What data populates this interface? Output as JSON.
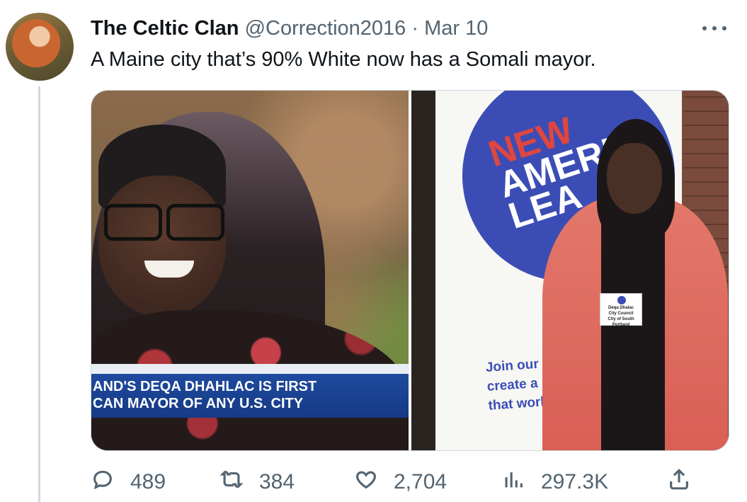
{
  "tweet": {
    "author": {
      "display_name": "The Celtic Clan",
      "handle": "@Correction2016",
      "separator": "·",
      "date": "Mar 10"
    },
    "text": "A Maine city that’s 90% White now has a Somali mayor.",
    "media": {
      "left_photo": {
        "chyron_line1": "AND'S DEQA DHAHLAC IS FIRST",
        "chyron_line2": "CAN MAYOR OF ANY U.S. CITY"
      },
      "right_photo": {
        "banner_line1": "NEW",
        "banner_line2": "AMERIC",
        "banner_line3": "LEA",
        "banner_tag_line1": "Join our",
        "banner_tag_line2": "create a",
        "banner_tag_line3": "that works",
        "badge_name": "Deqa Dhalac",
        "badge_title": "City Council",
        "badge_org": "City of South Portland"
      }
    },
    "actions": {
      "replies": "489",
      "retweets": "384",
      "likes": "2,704",
      "views": "297.3K"
    },
    "icons": {
      "more": "more-options-icon",
      "reply": "reply-icon",
      "retweet": "retweet-icon",
      "like": "heart-icon",
      "views": "analytics-icon",
      "share": "share-icon"
    }
  }
}
